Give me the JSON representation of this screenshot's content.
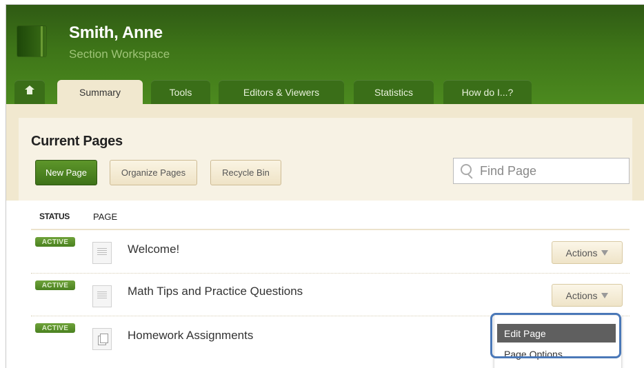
{
  "header": {
    "user_name": "Smith, Anne",
    "workspace_subtitle": "Section Workspace"
  },
  "tabs": [
    {
      "label": "",
      "icon": "home-icon"
    },
    {
      "label": "Summary",
      "active": true
    },
    {
      "label": "Tools"
    },
    {
      "label": "Editors & Viewers"
    },
    {
      "label": "Statistics"
    },
    {
      "label": "How do I...?"
    }
  ],
  "section": {
    "title": "Current Pages",
    "buttons": {
      "new_page": "New Page",
      "organize_pages": "Organize Pages",
      "recycle_bin": "Recycle Bin"
    },
    "search": {
      "placeholder": "Find Page",
      "value": ""
    }
  },
  "table": {
    "headers": {
      "status": "STATUS",
      "page": "PAGE"
    },
    "rows": [
      {
        "status": "ACTIVE",
        "title": "Welcome!",
        "actions": "Actions",
        "icon": "document-icon"
      },
      {
        "status": "ACTIVE",
        "title": "Math Tips and Practice Questions",
        "actions": "Actions",
        "icon": "document-icon"
      },
      {
        "status": "ACTIVE",
        "title": "Homework Assignments",
        "actions": "",
        "icon": "documents-icon"
      }
    ]
  },
  "actions_menu": {
    "items": [
      "Edit Page",
      "Page Options"
    ]
  },
  "colors": {
    "header_green": "#3e7518",
    "panel_beige": "#f1e8cf",
    "badge_green": "#5d962a",
    "callout_blue": "#4a78b8",
    "menu_highlight": "#5f5f5f"
  }
}
